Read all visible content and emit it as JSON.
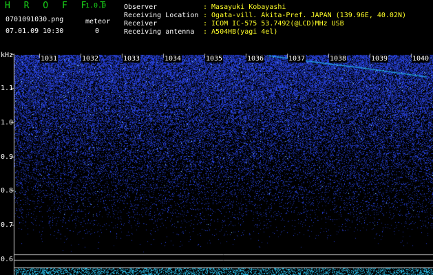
{
  "header": {
    "app_title": "H R O F F T",
    "version": "1.0.0",
    "filename": "0701091030.png",
    "datetime": "07.01.09 10:30",
    "meteor_label": "meteor",
    "meteor_count": "0",
    "fields": [
      {
        "label": "Observer",
        "value": ": Masayuki Kobayashi"
      },
      {
        "label": "Receiving Location",
        "value": ": Ogata-vill. Akita-Pref. JAPAN (139.96E, 40.02N)"
      },
      {
        "label": "Receiver",
        "value": ": ICOM IC-575 53.7492(@LCD)MHz USB"
      },
      {
        "label": "Receiving antenna",
        "value": ": A504HB(yagi 4el)"
      }
    ]
  },
  "spectrogram": {
    "y_unit": "kHz",
    "y_ticks": [
      "1.1",
      "1.0",
      "0.9",
      "0.8",
      "0.7",
      "0.6"
    ],
    "x_minute_labels": [
      "1031",
      "1032",
      "1033",
      "1034",
      "1035",
      "1036",
      "1037",
      "1038",
      "1039",
      "1040"
    ],
    "colors": {
      "noise": "#1e3cff",
      "frame": "#c8c8c8",
      "trace": "#28c8ff"
    }
  }
}
